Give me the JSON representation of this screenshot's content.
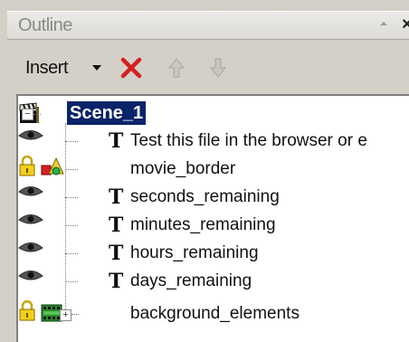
{
  "panel": {
    "title": "Outline",
    "close_label": "×"
  },
  "toolbar": {
    "insert_label": "Insert"
  },
  "tree": {
    "root": {
      "label": "Scene_1"
    },
    "items": [
      {
        "label": "Test this file in the browser or e",
        "type_glyph": "T"
      },
      {
        "label": "movie_border"
      },
      {
        "label": "seconds_remaining",
        "type_glyph": "T"
      },
      {
        "label": "minutes_remaining",
        "type_glyph": "T"
      },
      {
        "label": "hours_remaining",
        "type_glyph": "T"
      },
      {
        "label": "days_remaining",
        "type_glyph": "T"
      },
      {
        "label": "background_elements"
      }
    ]
  }
}
